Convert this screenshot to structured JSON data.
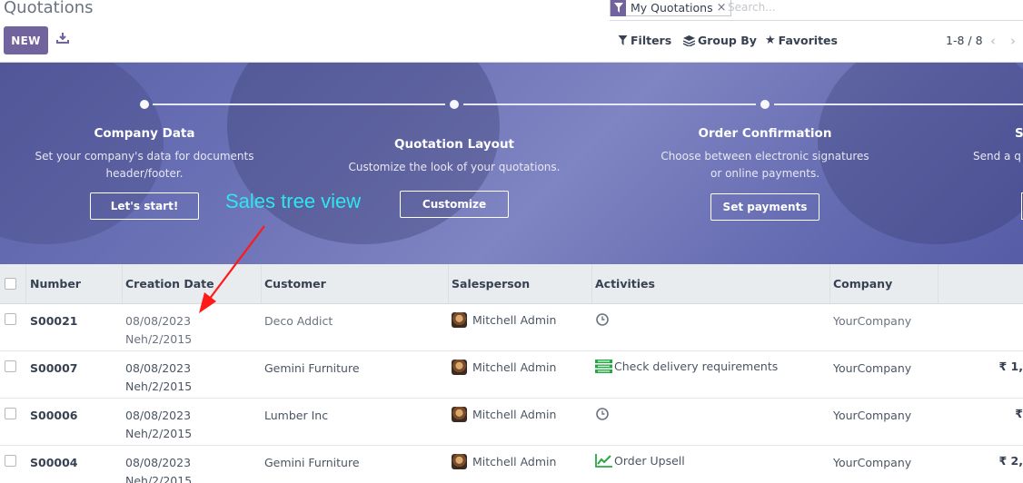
{
  "app": {
    "title": "Quotations"
  },
  "toolbar": {
    "new_label": "NEW",
    "filters_label": "Filters",
    "group_by_label": "Group By",
    "favorites_label": "Favorites",
    "pager": "1-8 / 8"
  },
  "search": {
    "facet_label": "My Quotations",
    "facet_remove": "×",
    "placeholder": "Search..."
  },
  "colors": {
    "brand": "#71639e",
    "banner": "#6c72b6",
    "annotation": "#2ee6ee",
    "annotation_arrow": "#ff1a1a"
  },
  "banner": {
    "steps": [
      {
        "title": "Company Data",
        "line1": "Set your company's data for documents",
        "line2": "header/footer.",
        "button": "Let's start!"
      },
      {
        "title": "Quotation Layout",
        "line1": "Customize the look of your quotations.",
        "line2": "",
        "button": "Customize"
      },
      {
        "title": "Order Confirmation",
        "line1": "Choose between electronic signatures",
        "line2": "or online payments.",
        "button": "Set payments"
      },
      {
        "title": "S",
        "line1": "Send a q",
        "line2": "",
        "button": ""
      }
    ]
  },
  "annotation": {
    "text": "Sales tree view"
  },
  "table": {
    "columns": [
      "Number",
      "Creation Date",
      "Customer",
      "Salesperson",
      "Activities",
      "Company"
    ],
    "rows": [
      {
        "number": "S00021",
        "date": "08/08/2023",
        "date_alt": "Neh/2/2015",
        "customer": "Deco Addict",
        "salesperson": "Mitchell Admin",
        "activity_icon": "clock-icon",
        "activity": "",
        "company": "YourCompany",
        "amount": ""
      },
      {
        "number": "S00007",
        "date": "08/08/2023",
        "date_alt": "Neh/2/2015",
        "customer": "Gemini Furniture",
        "salesperson": "Mitchell Admin",
        "activity_icon": "list-icon",
        "activity": "Check delivery requirements",
        "company": "YourCompany",
        "amount": "₹ 1,"
      },
      {
        "number": "S00006",
        "date": "08/08/2023",
        "date_alt": "Neh/2/2015",
        "customer": "Lumber Inc",
        "salesperson": "Mitchell Admin",
        "activity_icon": "clock-icon",
        "activity": "",
        "company": "YourCompany",
        "amount": "₹"
      },
      {
        "number": "S00004",
        "date": "08/08/2023",
        "date_alt": "Neh/2/2015",
        "customer": "Gemini Furniture",
        "salesperson": "Mitchell Admin",
        "activity_icon": "chart-icon",
        "activity": "Order Upsell",
        "company": "YourCompany",
        "amount": "₹ 2,"
      }
    ]
  }
}
